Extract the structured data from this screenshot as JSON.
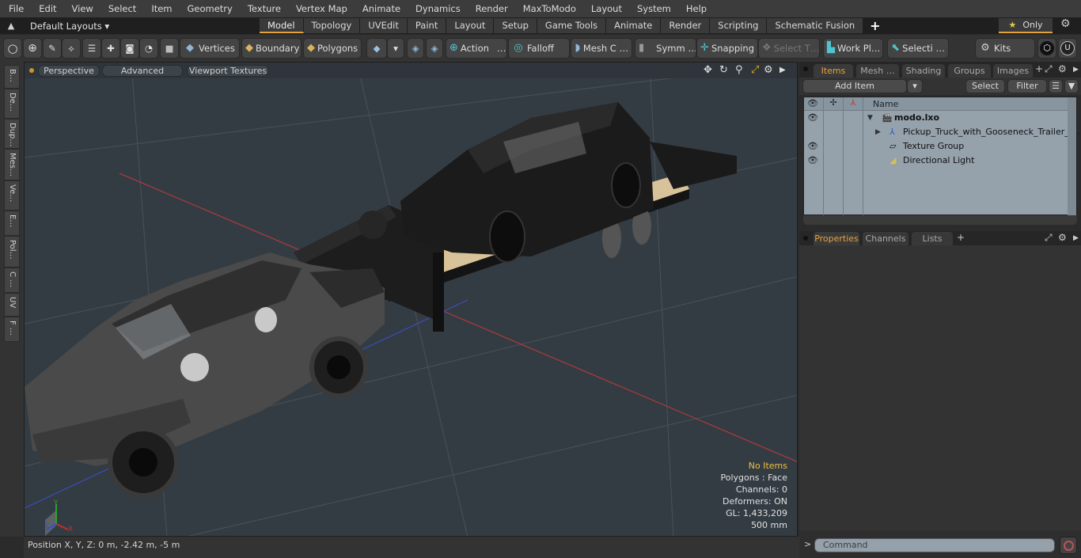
{
  "menu": [
    "File",
    "Edit",
    "View",
    "Select",
    "Item",
    "Geometry",
    "Texture",
    "Vertex Map",
    "Animate",
    "Dynamics",
    "Render",
    "MaxToModo",
    "Layout",
    "System",
    "Help"
  ],
  "layout_bar": {
    "layouts_label": "Default Layouts ▾",
    "tabs": [
      "Model",
      "Topology",
      "UVEdit",
      "Paint",
      "Layout",
      "Setup",
      "Game Tools",
      "Animate",
      "Render",
      "Scripting",
      "Schematic Fusion"
    ],
    "active_tab": "Model",
    "add_tab": "+",
    "only_label": "Only"
  },
  "toolbar": {
    "vertices": "Vertices",
    "boundary": "Boundary",
    "polygons": "Polygons",
    "action": "Action",
    "falloff": "Falloff",
    "mesh_c": "Mesh C …",
    "symm": "Symm …",
    "snapping": "Snapping",
    "select_t": "Select T…",
    "work_pl": "Work Pl…",
    "selecti": "Selecti …",
    "kits": "Kits"
  },
  "left_strip": [
    "B…",
    "De…",
    "Dup…",
    "Mes…",
    "Ve…",
    "E…",
    "Pol…",
    "C …",
    "UV",
    "F …"
  ],
  "viewport": {
    "view_mode": "Perspective",
    "shading": "Advanced",
    "textures": "Viewport Textures",
    "hud": {
      "selection": "No Items",
      "polygons": "Polygons : Face",
      "channels": "Channels: 0",
      "deformers": "Deformers: ON",
      "gl": "GL: 1,433,209",
      "scale": "500 mm"
    },
    "axes": {
      "x": "X",
      "y": "Y",
      "z": "Z"
    }
  },
  "status_bar": {
    "position": "Position X, Y, Z:   0 m, -2.42 m, -5 m"
  },
  "items_panel": {
    "tabs": [
      "Items",
      "Mesh …",
      "Shading",
      "Groups",
      "Images"
    ],
    "active_tab": "Items",
    "add_item": "Add Item",
    "select": "Select",
    "filter": "Filter",
    "column_name": "Name",
    "tree": [
      {
        "label": "modo.lxo",
        "visible": true,
        "level": 0,
        "expanded": true,
        "bold": true
      },
      {
        "label": "Pickup_Truck_with_Gooseneck_Trailer_a…",
        "visible": false,
        "level": 1,
        "collapsed": true
      },
      {
        "label": "Texture Group",
        "visible": true,
        "level": 1
      },
      {
        "label": "Directional Light",
        "visible": true,
        "level": 1
      }
    ]
  },
  "properties_panel": {
    "tabs": [
      "Properties",
      "Channels",
      "Lists"
    ],
    "active_tab": "Properties"
  },
  "command": {
    "prompt": ">",
    "placeholder": "Command"
  },
  "colors": {
    "accent": "#e2a23b",
    "viewport_bg": "#343c43",
    "tree_bg": "#95a1ab",
    "x_axis": "#c03a3a",
    "y_axis": "#3a9a3a",
    "z_axis": "#3a50d0"
  }
}
